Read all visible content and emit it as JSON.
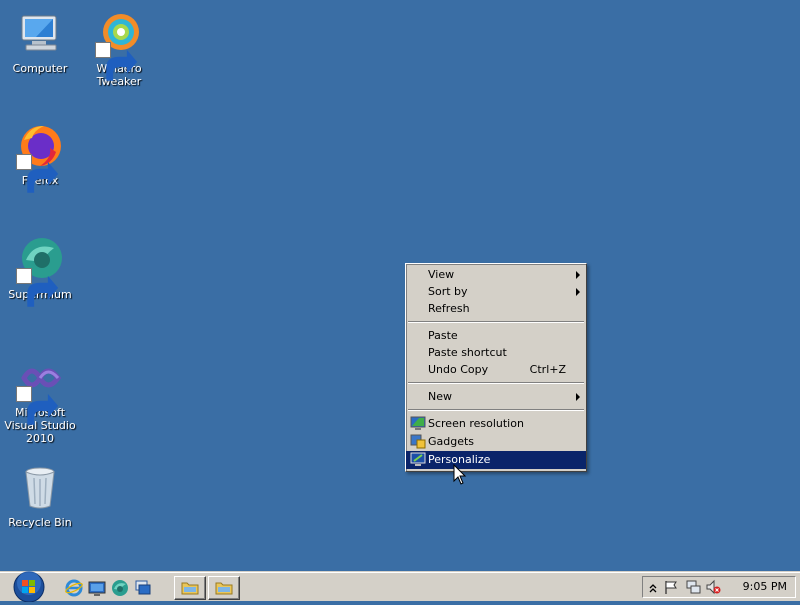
{
  "desktop": {
    "background_color": "#3a6ea5",
    "icons": [
      {
        "label": "Computer",
        "icon": "computer-icon"
      },
      {
        "label": "Winaero Tweaker",
        "icon": "winaero-tweaker-icon"
      },
      {
        "label": "Firefox",
        "icon": "firefox-icon"
      },
      {
        "label": "Supermium",
        "icon": "supermium-icon"
      },
      {
        "label": "Microsoft Visual Studio 2010",
        "icon": "visual-studio-icon"
      },
      {
        "label": "Recycle Bin",
        "icon": "recycle-bin-icon"
      }
    ]
  },
  "context_menu": {
    "items": {
      "view": "View",
      "sort_by": "Sort by",
      "refresh": "Refresh",
      "paste": "Paste",
      "paste_shortcut": "Paste shortcut",
      "undo_copy": "Undo Copy",
      "undo_copy_shortcut": "Ctrl+Z",
      "new": "New",
      "screen_resolution": "Screen resolution",
      "gadgets": "Gadgets",
      "personalize": "Personalize"
    },
    "selected_item": "Personalize",
    "highlight_color": "#0a246a"
  },
  "taskbar": {
    "quick_launch": [
      "internet-explorer-icon",
      "show-desktop-icon",
      "supermium-icon",
      "window-switcher-icon"
    ],
    "task_buttons": [
      "folder-icon",
      "folder-icon"
    ],
    "tray_icons": [
      "show-hidden-icons",
      "action-center-flag-icon",
      "network-icon",
      "volume-muted-icon"
    ],
    "clock": "9:05 PM"
  }
}
